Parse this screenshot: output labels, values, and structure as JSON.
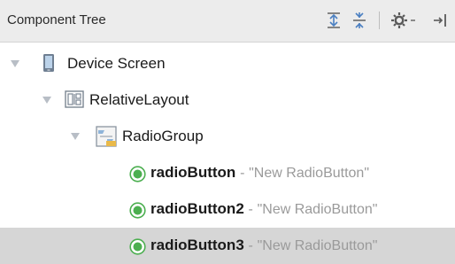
{
  "header": {
    "title": "Component Tree",
    "toolbar": {
      "expand_all_icon": "expand-all-icon",
      "collapse_all_icon": "collapse-all-icon",
      "settings_icon": "gear-dropdown-icon",
      "hide_icon": "hide-panel-icon"
    }
  },
  "tree": {
    "nodes": [
      {
        "label": "Device Screen",
        "icon": "device-icon"
      },
      {
        "label": "RelativeLayout",
        "icon": "relative-layout-icon"
      },
      {
        "label": "RadioGroup",
        "icon": "radio-group-icon"
      },
      {
        "label": "radioButton",
        "separator": "-",
        "description": "\"New RadioButton\"",
        "icon": "radio-button-icon"
      },
      {
        "label": "radioButton2",
        "separator": "-",
        "description": "\"New RadioButton\"",
        "icon": "radio-button-icon"
      },
      {
        "label": "radioButton3",
        "separator": "-",
        "description": "\"New RadioButton\"",
        "icon": "radio-button-icon",
        "selected": true
      }
    ]
  },
  "colors": {
    "header_bg": "#ececec",
    "selection_bg": "#d6d6d6",
    "radio_green": "#4caf50",
    "description_gray": "#9a9a9a"
  }
}
